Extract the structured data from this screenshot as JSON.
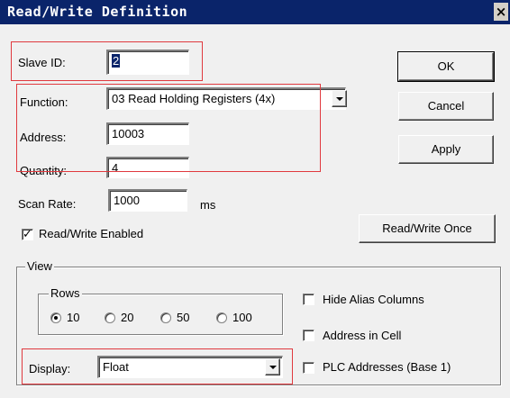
{
  "dialog": {
    "title": "Read/Write Definition",
    "close_label": "×"
  },
  "form": {
    "slave_id_label": "Slave ID:",
    "slave_id_value": "2",
    "function_label": "Function:",
    "function_value": "03 Read Holding Registers (4x)",
    "address_label": "Address:",
    "address_value": "10003",
    "quantity_label": "Quantity:",
    "quantity_value": "4",
    "scan_rate_label": "Scan Rate:",
    "scan_rate_value": "1000",
    "scan_rate_unit": "ms",
    "rw_enabled_label": "Read/Write Enabled",
    "rw_enabled_checked": true
  },
  "buttons": {
    "ok": "OK",
    "cancel": "Cancel",
    "apply": "Apply",
    "read_write_once": "Read/Write Once"
  },
  "view": {
    "group_label": "View",
    "rows_label": "Rows",
    "rows_options": [
      "10",
      "20",
      "50",
      "100"
    ],
    "rows_selected": "10",
    "hide_alias_columns_label": "Hide Alias Columns",
    "address_in_cell_label": "Address in Cell",
    "plc_addresses_label": "PLC Addresses (Base 1)",
    "display_label": "Display:",
    "display_value": "Float"
  },
  "colors": {
    "titlebar": "#0a246a",
    "highlight": "#e0393e",
    "dialog_bg": "#f0f0f0"
  }
}
